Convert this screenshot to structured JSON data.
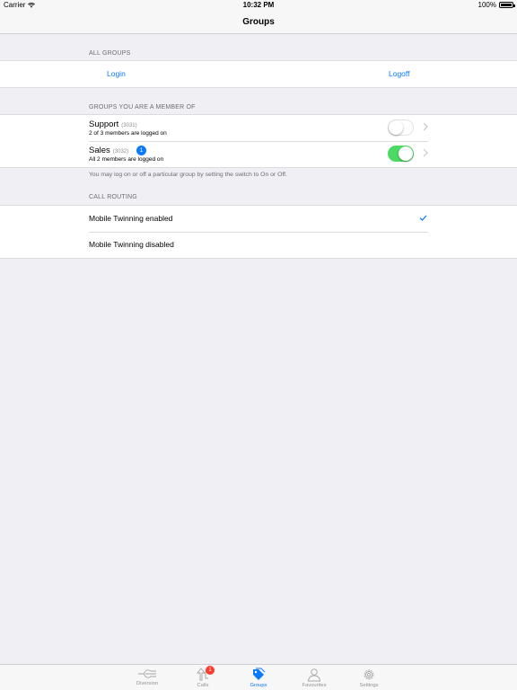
{
  "status_bar": {
    "carrier": "Carrier",
    "time": "10:32 PM",
    "battery": "100%"
  },
  "nav": {
    "title": "Groups"
  },
  "all_groups": {
    "header": "ALL GROUPS",
    "login_label": "Login",
    "logoff_label": "Logoff"
  },
  "member_groups": {
    "header": "GROUPS YOU ARE A MEMBER OF",
    "items": [
      {
        "name": "Support",
        "code": "(3031)",
        "status": "2 of 3 members are logged on",
        "badge": "",
        "switch_on": false
      },
      {
        "name": "Sales",
        "code": "(3032)",
        "status": "All 2 members are logged on",
        "badge": "1",
        "switch_on": true
      }
    ],
    "footer": "You may log on or off a particular group by setting the switch to On or Off."
  },
  "call_routing": {
    "header": "CALL ROUTING",
    "options": [
      {
        "label": "Mobile Twinning enabled",
        "selected": true
      },
      {
        "label": "Mobile Twinning disabled",
        "selected": false
      }
    ]
  },
  "tab_bar": {
    "tabs": [
      {
        "label": "Diversion",
        "icon": "diversion-icon",
        "active": false
      },
      {
        "label": "Calls",
        "icon": "calls-icon",
        "badge": "1",
        "active": false
      },
      {
        "label": "Groups",
        "icon": "groups-tag-icon",
        "active": true
      },
      {
        "label": "Favourites",
        "icon": "person-icon",
        "active": false
      },
      {
        "label": "Settings",
        "icon": "gear-icon",
        "active": false
      }
    ]
  },
  "colors": {
    "accent": "#0a7aff",
    "switch_on": "#4cd964",
    "badge_red": "#ff3b30",
    "background": "#efeff4"
  }
}
